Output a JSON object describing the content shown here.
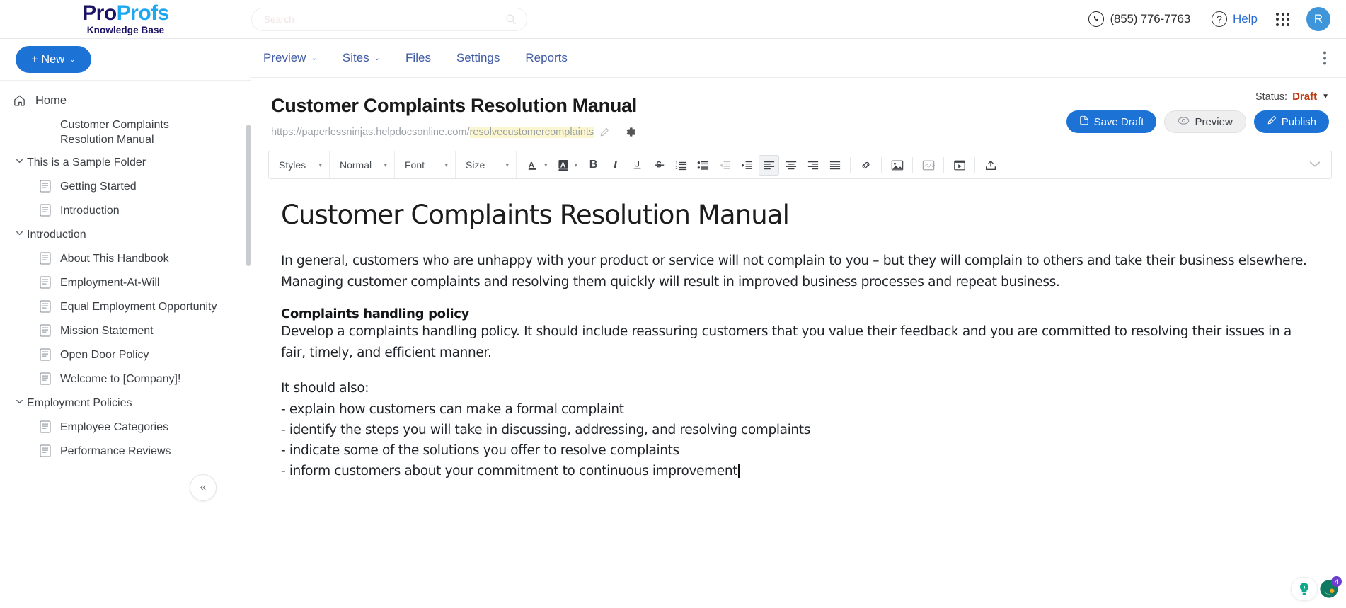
{
  "brand": {
    "name_part1": "Pro",
    "name_part2": "Profs",
    "subtitle": "Knowledge Base"
  },
  "search": {
    "placeholder": "Search",
    "value": ""
  },
  "topbar": {
    "phone": "(855) 776-7763",
    "help_label": "Help",
    "help_glyph": "?",
    "avatar_initial": "R"
  },
  "sidebar": {
    "new_button": "+ New",
    "new_caret": "⌄",
    "collapse_glyph": "«",
    "items": [
      {
        "label": "Home",
        "icon": "home-icon",
        "type": "root",
        "indent": 0
      },
      {
        "label": "Customer Complaints Resolution Manual",
        "icon": "none",
        "type": "page-active",
        "indent": 1
      },
      {
        "label": "This is a Sample Folder",
        "icon": "chevron-down-icon",
        "type": "folder",
        "indent": 0
      },
      {
        "label": "Getting Started",
        "icon": "document-icon",
        "type": "page",
        "indent": 1
      },
      {
        "label": "Introduction",
        "icon": "document-icon",
        "type": "page",
        "indent": 1
      },
      {
        "label": "Introduction",
        "icon": "chevron-down-icon",
        "type": "folder",
        "indent": 0
      },
      {
        "label": "About This Handbook",
        "icon": "document-icon",
        "type": "page",
        "indent": 1
      },
      {
        "label": "Employment-At-Will",
        "icon": "document-icon",
        "type": "page",
        "indent": 1
      },
      {
        "label": "Equal Employment Opportunity",
        "icon": "document-icon",
        "type": "page",
        "indent": 1
      },
      {
        "label": "Mission Statement",
        "icon": "document-icon",
        "type": "page",
        "indent": 1
      },
      {
        "label": "Open Door Policy",
        "icon": "document-icon",
        "type": "page",
        "indent": 1
      },
      {
        "label": "Welcome to [Company]!",
        "icon": "document-icon",
        "type": "page",
        "indent": 1
      },
      {
        "label": "Employment Policies",
        "icon": "chevron-down-icon",
        "type": "folder",
        "indent": 0
      },
      {
        "label": "Employee Categories",
        "icon": "document-icon",
        "type": "page",
        "indent": 1
      },
      {
        "label": "Performance Reviews",
        "icon": "document-icon",
        "type": "page",
        "indent": 1
      }
    ]
  },
  "nav": {
    "tabs": [
      {
        "label": "Preview",
        "has_caret": true
      },
      {
        "label": "Sites",
        "has_caret": true
      },
      {
        "label": "Files",
        "has_caret": false
      },
      {
        "label": "Settings",
        "has_caret": false
      },
      {
        "label": "Reports",
        "has_caret": false
      }
    ],
    "caret_glyph": "⌄"
  },
  "document": {
    "title": "Customer Complaints Resolution Manual",
    "url_base": "https://paperlessninjas.helpdocsonline.com/",
    "url_slug": "resolvecustomercomplaints",
    "status_label": "Status:",
    "status_value": "Draft",
    "status_caret": "▼",
    "buttons": {
      "save_draft": "Save Draft",
      "preview": "Preview",
      "publish": "Publish"
    }
  },
  "toolbar": {
    "selects": [
      {
        "label": "Styles",
        "name": "styles-select"
      },
      {
        "label": "Normal",
        "name": "format-select"
      },
      {
        "label": "Font",
        "name": "font-select"
      },
      {
        "label": "Size",
        "name": "size-select"
      }
    ],
    "caret_glyph": "▾",
    "buttons": [
      {
        "name": "text-color-button",
        "glyph": "A"
      },
      {
        "name": "background-color-button",
        "glyph": "A"
      },
      {
        "name": "bold-button",
        "glyph": "B"
      },
      {
        "name": "italic-button",
        "glyph": "I"
      },
      {
        "name": "underline-button",
        "glyph": "U"
      },
      {
        "name": "strikethrough-button",
        "glyph": "S"
      },
      {
        "name": "numbered-list-button",
        "glyph": ""
      },
      {
        "name": "bullet-list-button",
        "glyph": ""
      },
      {
        "name": "outdent-button",
        "glyph": ""
      },
      {
        "name": "indent-button",
        "glyph": ""
      },
      {
        "name": "align-left-button",
        "glyph": ""
      },
      {
        "name": "align-center-button",
        "glyph": ""
      },
      {
        "name": "align-right-button",
        "glyph": ""
      },
      {
        "name": "align-justify-button",
        "glyph": ""
      },
      {
        "name": "insert-link-button",
        "glyph": ""
      },
      {
        "name": "insert-image-button",
        "glyph": ""
      },
      {
        "name": "insert-code-button",
        "glyph": ""
      },
      {
        "name": "insert-video-button",
        "glyph": ""
      },
      {
        "name": "upload-button",
        "glyph": ""
      }
    ],
    "collapse_glyph": "⌄"
  },
  "editor": {
    "heading": "Customer Complaints Resolution Manual",
    "paragraph1": "In general, customers who are unhappy with your product or service will not complain to you – but they will complain to others and take their business elsewhere. Managing customer complaints and resolving them quickly will result in improved business processes and repeat business.",
    "section_heading": "Complaints handling policy",
    "paragraph2": "Develop a complaints handling policy. It should include reassuring customers that you value their feedback and you are committed to resolving their issues in a fair, timely, and efficient manner.",
    "list_intro": "It should also:",
    "list_items": [
      "- explain how customers can make a formal complaint",
      "- identify the steps you will take in discussing, addressing, and resolving complaints",
      "- indicate some of the solutions you offer to resolve complaints",
      "- inform customers about your commitment to continuous improvement"
    ]
  },
  "floating": {
    "chat_badge": "4"
  },
  "colors": {
    "brand_dark": "#1b1464",
    "brand_light": "#1fa8f2",
    "primary_button": "#1d72d6",
    "nav_link": "#3f5aa6",
    "status_draft": "#c0390f",
    "slug_highlight": "#fbf6d0"
  }
}
